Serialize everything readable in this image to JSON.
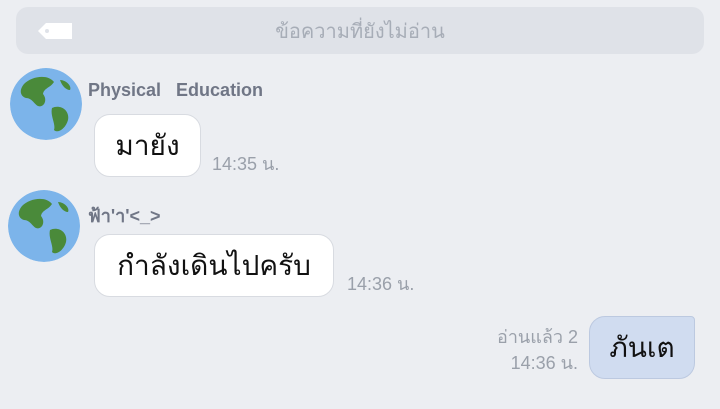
{
  "unread_banner": {
    "text": "ข้อความที่ยังไม่อ่าน",
    "icon": "tag-icon"
  },
  "messages": [
    {
      "sender": "Physical   Education",
      "text": "มายัง",
      "time": "14:35 น.",
      "avatar_icon": "earth-globe-icon"
    },
    {
      "sender": "ฟ้า'า'<_>",
      "text": "กำลังเดินไปครับ",
      "time": "14:36 น.",
      "avatar_icon": "earth-globe-icon"
    },
    {
      "text": "ภันเต",
      "read_status": "อ่านแล้ว 2",
      "time": "14:36 น."
    }
  ],
  "colors": {
    "background": "#eceef2",
    "own_bubble": "#d0dcf0",
    "ocean": "#7cb4ea",
    "land": "#4a8a3a"
  }
}
